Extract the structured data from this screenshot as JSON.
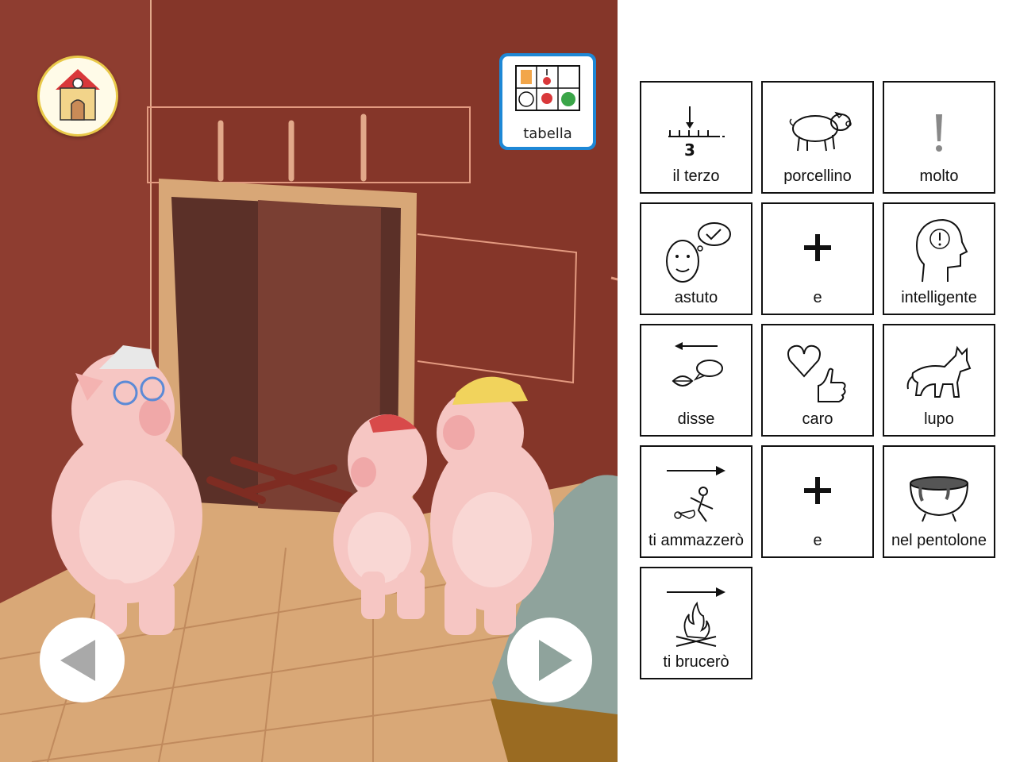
{
  "app": {
    "table_button_label": "tabella"
  },
  "navigation": {
    "home_icon": "house-icon",
    "prev_icon": "triangle-left-icon",
    "next_icon": "triangle-right-icon"
  },
  "cards": [
    {
      "label": "il terzo",
      "icon": "number-line-three-icon"
    },
    {
      "label": "porcellino",
      "icon": "pig-icon"
    },
    {
      "label": "molto",
      "icon": "exclamation-icon"
    },
    {
      "label": "astuto",
      "icon": "thinking-face-icon"
    },
    {
      "label": "e",
      "icon": "plus-icon"
    },
    {
      "label": "intelligente",
      "icon": "head-exclamation-icon"
    },
    {
      "label": "disse",
      "icon": "speaking-lips-icon"
    },
    {
      "label": "caro",
      "icon": "heart-thumb-icon"
    },
    {
      "label": "lupo",
      "icon": "wolf-icon"
    },
    {
      "label": "ti ammazzerò",
      "icon": "kill-future-icon"
    },
    {
      "label": "e",
      "icon": "plus-icon"
    },
    {
      "label": "nel pentolone",
      "icon": "cauldron-icon"
    },
    {
      "label": "ti brucerò",
      "icon": "fire-future-icon"
    }
  ],
  "colors": {
    "wall": "#8b3a2e",
    "floor": "#d9a877",
    "pig": "#f6c6c3",
    "nav_button": "#ffffff",
    "table_border": "#1e88d6"
  }
}
